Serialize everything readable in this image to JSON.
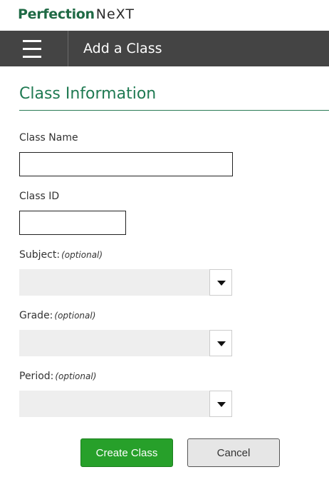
{
  "logo": {
    "brand": "Perfection",
    "suffix": "NeXT"
  },
  "header": {
    "title": "Add a Class",
    "menu_icon": "hamburger-menu-icon"
  },
  "section": {
    "title": "Class Information"
  },
  "fields": {
    "class_name": {
      "label": "Class Name",
      "value": ""
    },
    "class_id": {
      "label": "Class ID",
      "value": ""
    },
    "subject": {
      "label": "Subject:",
      "optional": "(optional)",
      "value": ""
    },
    "grade": {
      "label": "Grade:",
      "optional": "(optional)",
      "value": ""
    },
    "period": {
      "label": "Period:",
      "optional": "(optional)",
      "value": ""
    }
  },
  "buttons": {
    "create": "Create Class",
    "cancel": "Cancel"
  },
  "colors": {
    "brand_green": "#1f7a52",
    "header_bg": "#444444",
    "create_bg": "#27a02a",
    "cancel_bg": "#e6e6e6"
  }
}
